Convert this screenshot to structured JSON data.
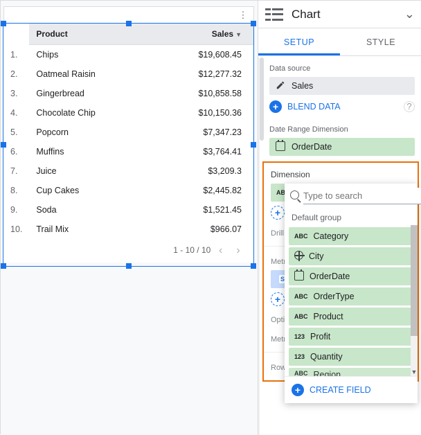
{
  "chart": {
    "columns": {
      "product": "Product",
      "sales": "Sales"
    },
    "rows": [
      {
        "n": "1.",
        "product": "Chips",
        "sales": "$19,608.45"
      },
      {
        "n": "2.",
        "product": "Oatmeal Raisin",
        "sales": "$12,277.32"
      },
      {
        "n": "3.",
        "product": "Gingerbread",
        "sales": "$10,858.58"
      },
      {
        "n": "4.",
        "product": "Chocolate Chip",
        "sales": "$10,150.36"
      },
      {
        "n": "5.",
        "product": "Popcorn",
        "sales": "$7,347.23"
      },
      {
        "n": "6.",
        "product": "Muffins",
        "sales": "$3,764.41"
      },
      {
        "n": "7.",
        "product": "Juice",
        "sales": "$3,209.3"
      },
      {
        "n": "8.",
        "product": "Cup Cakes",
        "sales": "$2,445.82"
      },
      {
        "n": "9.",
        "product": "Soda",
        "sales": "$1,521.45"
      },
      {
        "n": "10.",
        "product": "Trail Mix",
        "sales": "$966.07"
      }
    ],
    "pager": "1 - 10 / 10"
  },
  "panel": {
    "title": "Chart",
    "tabs": {
      "setup": "SETUP",
      "style": "STYLE"
    },
    "dataSourceLabel": "Data source",
    "dataSource": "Sales",
    "blendData": "BLEND DATA",
    "dateRangeLabel": "Date Range Dimension",
    "dateRange": "OrderDate",
    "dimensionLabel": "Dimension",
    "dimensionChipType": "ABC",
    "drillDown": "Drill d",
    "metricLabel": "Metri",
    "metricChipType": "SUM",
    "optionalLabel": "Optio",
    "metricLabel2": "Metri",
    "rowsPer": "Rows p",
    "popup": {
      "searchPlaceholder": "Type to search",
      "group": "Default group",
      "fields": [
        {
          "type": "abc",
          "name": "Category"
        },
        {
          "type": "geo",
          "name": "City"
        },
        {
          "type": "cal",
          "name": "OrderDate"
        },
        {
          "type": "abc",
          "name": "OrderType"
        },
        {
          "type": "abc",
          "name": "Product"
        },
        {
          "type": "num",
          "name": "Profit"
        },
        {
          "type": "num",
          "name": "Quantity"
        },
        {
          "type": "abc",
          "name": "Region"
        }
      ],
      "createField": "CREATE FIELD"
    }
  },
  "chart_data": {
    "type": "table",
    "title": "",
    "columns": [
      "Product",
      "Sales"
    ],
    "rows": [
      [
        "Chips",
        19608.45
      ],
      [
        "Oatmeal Raisin",
        12277.32
      ],
      [
        "Gingerbread",
        10858.58
      ],
      [
        "Chocolate Chip",
        10150.36
      ],
      [
        "Popcorn",
        7347.23
      ],
      [
        "Muffins",
        3764.41
      ],
      [
        "Juice",
        3209.3
      ],
      [
        "Cup Cakes",
        2445.82
      ],
      [
        "Soda",
        1521.45
      ],
      [
        "Trail Mix",
        966.07
      ]
    ],
    "sort": {
      "column": "Sales",
      "dir": "desc"
    },
    "page": {
      "start": 1,
      "end": 10,
      "total": 10
    }
  }
}
